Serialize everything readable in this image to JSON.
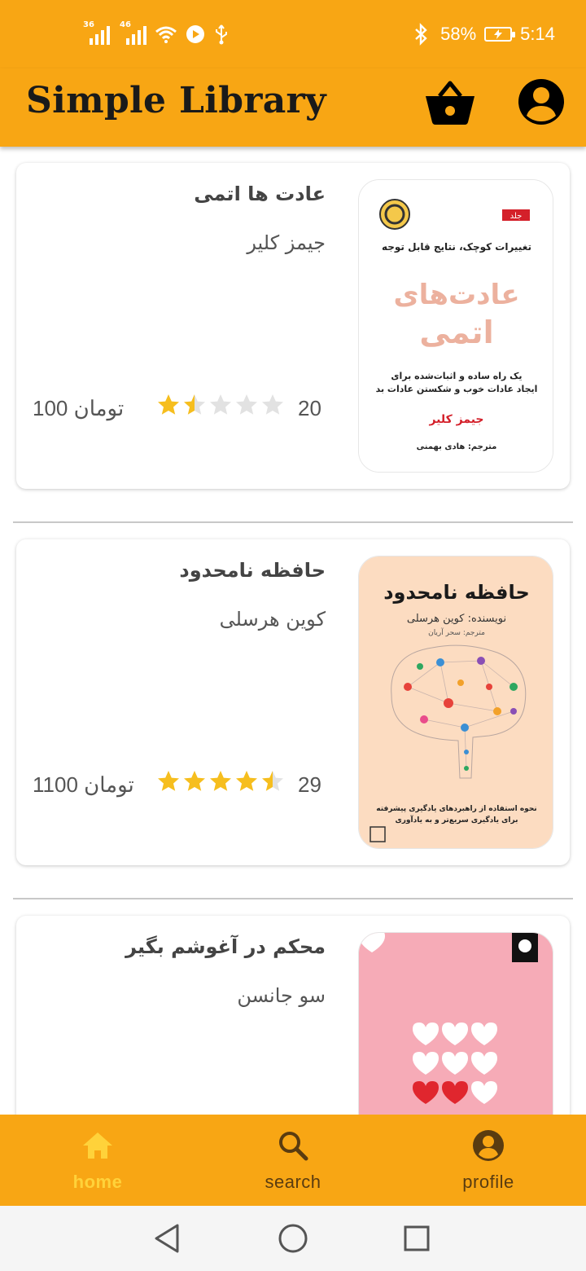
{
  "status_bar": {
    "net1": "36",
    "net2": "46",
    "battery_percent": "58%",
    "time": "5:14"
  },
  "app_bar": {
    "title": "Simple Library",
    "cart_icon": "shopping-basket-icon",
    "profile_icon": "account-circle-icon"
  },
  "books": [
    {
      "title": "عادت ها اتمی",
      "author": "جیمز کلیر",
      "price": "100 تومان",
      "rating": 1.5,
      "count": "20",
      "cover": {
        "bg": "#ffffff",
        "tag": "جلد",
        "subtitle": "تغییرات کوچک، نتایج قابل توجه",
        "big_line1": "عادت‌های",
        "big_line2": "اتمی",
        "desc_line1": "یک راه ساده و اثبات‌شده برای",
        "desc_line2": "ایجاد عادات خوب و شکستن عادات بد",
        "author": "جیمز کلیر",
        "translator": "مترجم: هادی بهمنی"
      }
    },
    {
      "title": "حافظه نامحدود",
      "author": "کوین هرسلی",
      "price": "1100 تومان",
      "rating": 4.5,
      "count": "29",
      "cover": {
        "bg": "#FCDCC1",
        "title": "حافظه نامحدود",
        "author_line": "نویسنده: کوین هرسلی",
        "translator": "مترجم: سحر آریان",
        "desc_line1": "نحوه استفاده از راهبردهای یادگیری پیشرفته",
        "desc_line2": "برای یادگیری سریع‌تر و به یادآوری"
      }
    },
    {
      "title": "محکم در آغوشم بگیر",
      "author": "سو جانسن",
      "cover": {
        "bg": "#F6ABB7"
      }
    }
  ],
  "bottom_nav": [
    {
      "label": "home",
      "icon": "home-icon",
      "active": true
    },
    {
      "label": "search",
      "icon": "search-icon",
      "active": false
    },
    {
      "label": "profile",
      "icon": "account-circle-icon",
      "active": false
    }
  ],
  "system_nav": {
    "back_icon": "back-triangle-icon",
    "home_icon": "home-circle-icon",
    "recents_icon": "recents-square-icon"
  },
  "colors": {
    "primary": "#F8A614",
    "active_nav": "#FFD23A",
    "star": "#F6BE1E",
    "star_empty": "#E2E2E2"
  }
}
